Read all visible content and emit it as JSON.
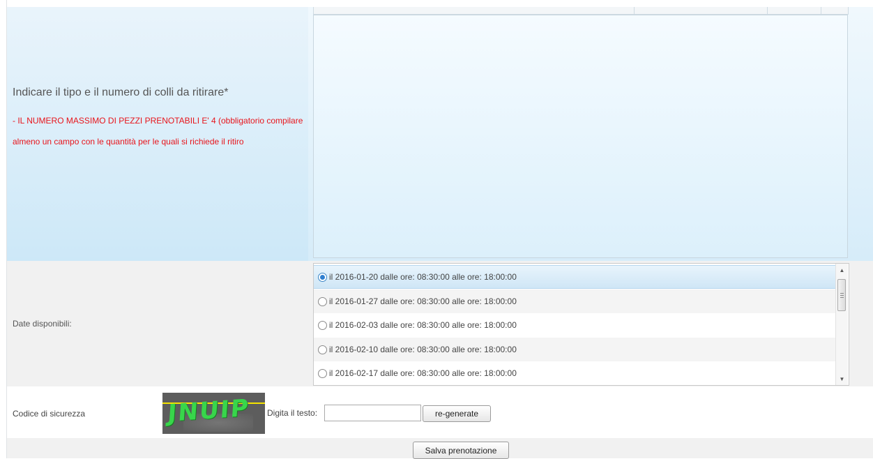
{
  "pickup_section": {
    "label": "Indicare il tipo e il numero di colli da ritirare*",
    "note": "- IL NUMERO MASSIMO DI PEZZI PRENOTABILI E' 4 (obbligatorio compilare almeno un campo con le quantità per le quali si richiede il ritiro"
  },
  "dates_section": {
    "label": "Date disponibili:",
    "options": [
      {
        "text": "il 2016-01-20 dalle ore: 08:30:00 alle ore: 18:00:00",
        "selected": true
      },
      {
        "text": "il 2016-01-27 dalle ore: 08:30:00 alle ore: 18:00:00",
        "selected": false
      },
      {
        "text": "il 2016-02-03 dalle ore: 08:30:00 alle ore: 18:00:00",
        "selected": false
      },
      {
        "text": "il 2016-02-10 dalle ore: 08:30:00 alle ore: 18:00:00",
        "selected": false
      },
      {
        "text": "il 2016-02-17 dalle ore: 08:30:00 alle ore: 18:00:00",
        "selected": false
      }
    ]
  },
  "security": {
    "label": "Codice di sicurezza",
    "captcha_text": "JNUIP",
    "input_label": "Digita il testo:",
    "input_value": "",
    "regenerate_label": "re-generate"
  },
  "footer": {
    "save_label": "Salva prenotazione"
  },
  "colors": {
    "note_red": "#e8141b",
    "selection_blue": "#2f7fd0",
    "captcha_green": "#38d64b",
    "captcha_bar": "#f5e400"
  }
}
